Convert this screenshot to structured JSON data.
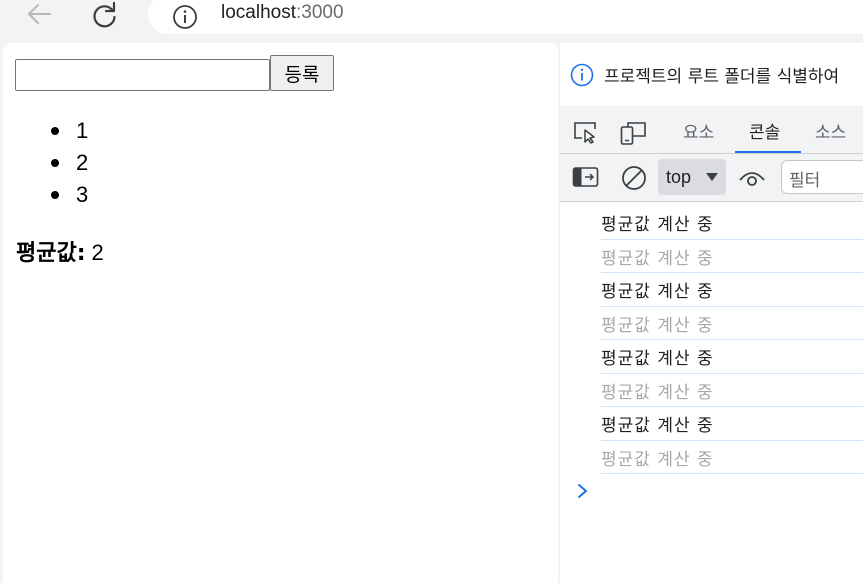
{
  "browser": {
    "url_host": "localhost",
    "url_port": ":3000"
  },
  "page": {
    "submit_label": "등록",
    "input_value": "",
    "list_items": [
      "1",
      "2",
      "3"
    ],
    "average_label": "평균값:",
    "average_value": "2"
  },
  "devtools": {
    "banner_text": "프로젝트의 루트 폴더를 식별하여",
    "tabs": [
      "요소",
      "콘솔",
      "소스"
    ],
    "active_tab": "콘솔",
    "context_label": "top",
    "filter_placeholder": "필터",
    "logs": [
      {
        "text": "평균값 계산 중",
        "faded": false
      },
      {
        "text": "평균값 계산 중",
        "faded": true
      },
      {
        "text": "평균값 계산 중",
        "faded": false
      },
      {
        "text": "평균값 계산 중",
        "faded": true
      },
      {
        "text": "평균값 계산 중",
        "faded": false
      },
      {
        "text": "평균값 계산 중",
        "faded": true
      },
      {
        "text": "평균값 계산 중",
        "faded": false
      },
      {
        "text": "평균값 계산 중",
        "faded": true
      }
    ],
    "accent_color": "#1a73e8"
  },
  "icons": [
    "back-arrow-icon",
    "reload-icon",
    "info-icon",
    "inspect-element-icon",
    "device-toolbar-icon",
    "sidebar-toggle-icon",
    "clear-console-icon",
    "eye-icon",
    "prompt-chevron-icon"
  ]
}
